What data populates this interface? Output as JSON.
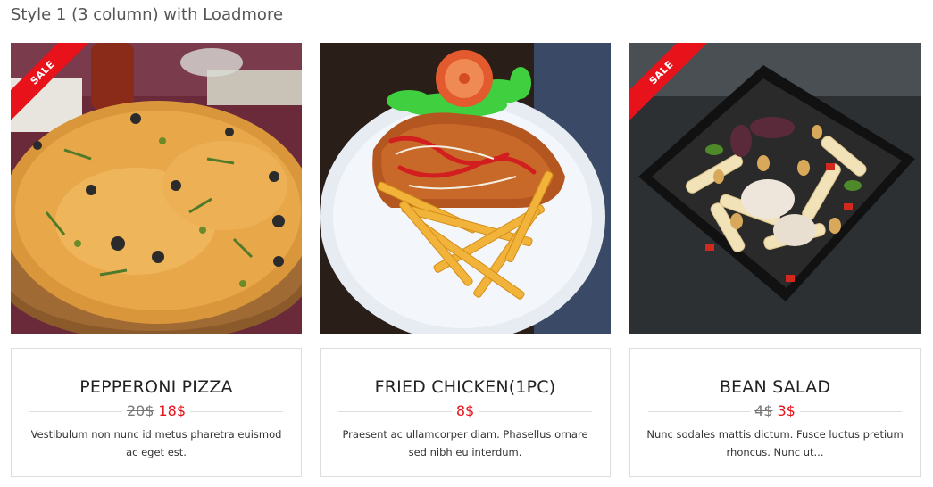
{
  "heading": "Style 1 (3 column) with Loadmore",
  "sale_label": "SALE",
  "items": [
    {
      "title": "PEPPERONI PIZZA",
      "old_price": "20$",
      "price": "18$",
      "description": "Vestibulum non nunc id metus pharetra euismod ac eget est.",
      "on_sale": true,
      "image": "pizza-image"
    },
    {
      "title": "FRIED CHICKEN(1PC)",
      "old_price": "",
      "price": "8$",
      "description": "Praesent ac ullamcorper diam. Phasellus ornare sed nibh eu interdum.",
      "on_sale": false,
      "image": "fried-chicken-image"
    },
    {
      "title": "BEAN SALAD",
      "old_price": "4$",
      "price": "3$",
      "description": "Nunc sodales mattis dictum. Fusce luctus pretium rhoncus. Nunc ut...",
      "on_sale": true,
      "image": "bean-salad-image"
    }
  ],
  "colors": {
    "sale_red": "#e8121b",
    "price_red": "#e8121b",
    "border": "#dddddd"
  }
}
